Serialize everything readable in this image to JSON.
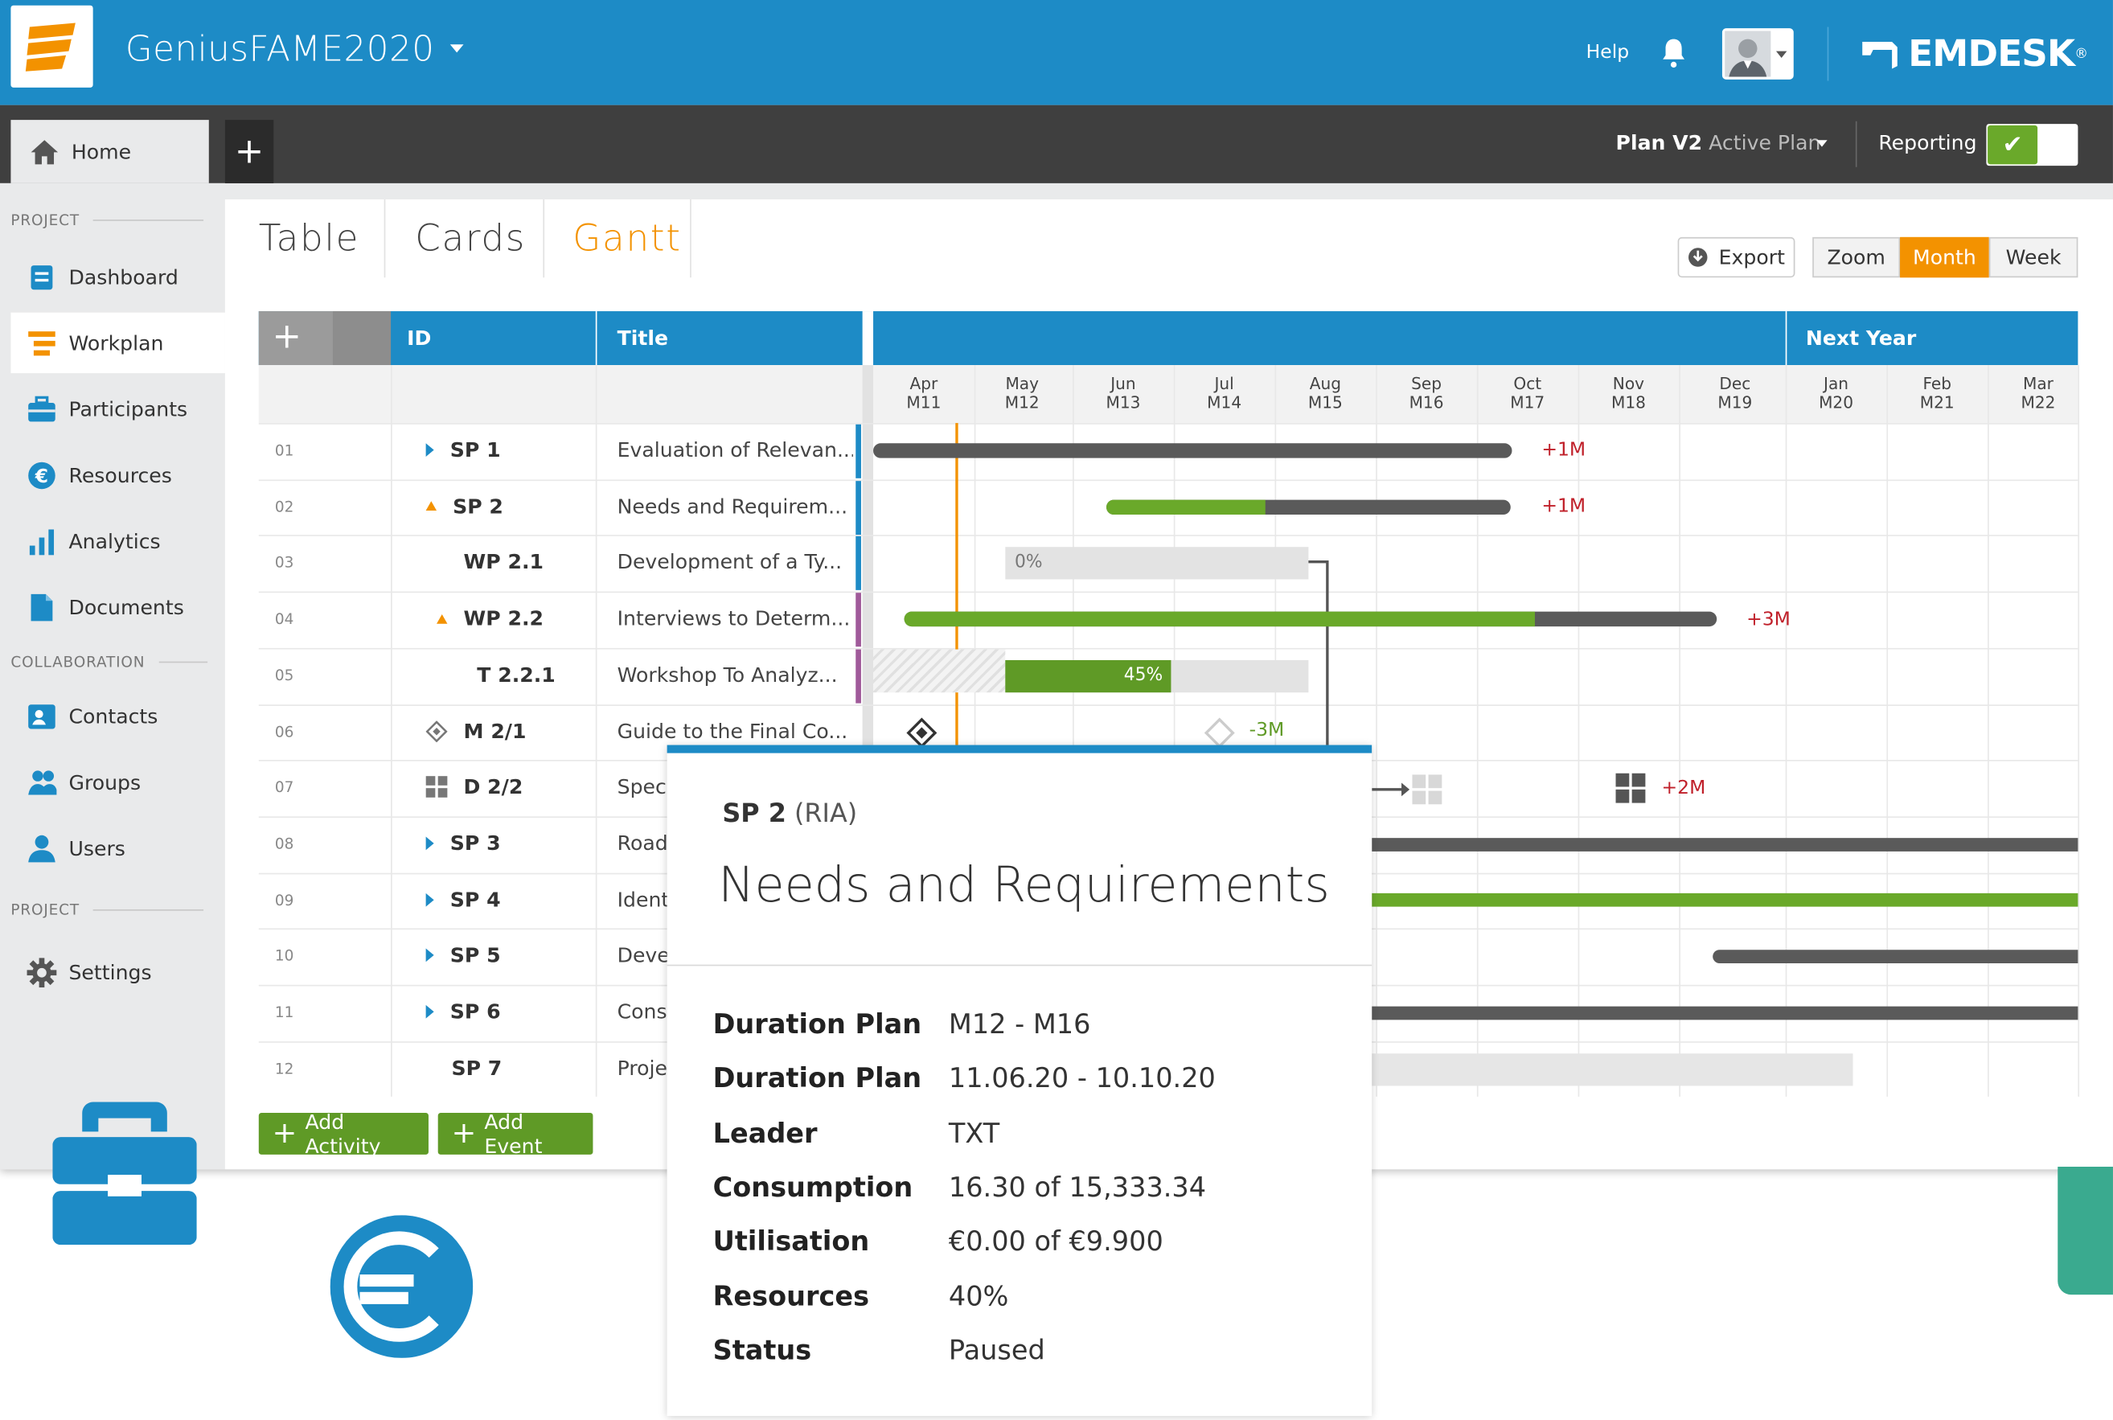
{
  "app": {
    "project": "GeniusFAME2020",
    "help": "Help",
    "brand": "EMDESK",
    "brand_mark": "®"
  },
  "subbar": {
    "home": "Home",
    "plan_name": "Plan V2",
    "plan_status": "Active Plan",
    "reporting": "Reporting"
  },
  "sidebar": {
    "sections": [
      "PROJECT",
      "COLLABORATION",
      "PROJECT"
    ],
    "items": [
      {
        "label": "Dashboard",
        "icon": "dashboard-icon"
      },
      {
        "label": "Workplan",
        "icon": "workplan-icon",
        "active": true
      },
      {
        "label": "Participants",
        "icon": "briefcase-icon"
      },
      {
        "label": "Resources",
        "icon": "euro-icon"
      },
      {
        "label": "Analytics",
        "icon": "bar-chart-icon"
      },
      {
        "label": "Documents",
        "icon": "document-icon"
      },
      {
        "label": "Contacts",
        "icon": "contact-card-icon"
      },
      {
        "label": "Groups",
        "icon": "group-icon"
      },
      {
        "label": "Users",
        "icon": "user-icon"
      },
      {
        "label": "Settings",
        "icon": "gear-icon"
      }
    ]
  },
  "views": {
    "table": "Table",
    "cards": "Cards",
    "gantt": "Gantt",
    "active": "Gantt"
  },
  "toolbar": {
    "export": "Export",
    "zoom": "Zoom",
    "month": "Month",
    "week": "Week",
    "active_zoom": "Month"
  },
  "grid": {
    "col_id": "ID",
    "col_title": "Title",
    "next_year": "Next Year",
    "months": [
      {
        "m": "Apr",
        "n": "M11"
      },
      {
        "m": "May",
        "n": "M12"
      },
      {
        "m": "Jun",
        "n": "M13"
      },
      {
        "m": "Jul",
        "n": "M14"
      },
      {
        "m": "Aug",
        "n": "M15"
      },
      {
        "m": "Sep",
        "n": "M16"
      },
      {
        "m": "Oct",
        "n": "M17"
      },
      {
        "m": "Nov",
        "n": "M18"
      },
      {
        "m": "Dec",
        "n": "M19"
      },
      {
        "m": "Jan",
        "n": "M20"
      },
      {
        "m": "Feb",
        "n": "M21"
      },
      {
        "m": "Mar",
        "n": "M22"
      }
    ],
    "rows": [
      {
        "num": "01",
        "id": "SP 1",
        "title": "Evaluation of Relevan...",
        "delta": "+1M"
      },
      {
        "num": "02",
        "id": "SP 2",
        "title": "Needs and Requirem...",
        "delta": "+1M"
      },
      {
        "num": "03",
        "id": "WP 2.1",
        "title": "Development of a Ty...",
        "progress": "0%"
      },
      {
        "num": "04",
        "id": "WP 2.2",
        "title": "Interviews to Determ...",
        "delta": "+3M"
      },
      {
        "num": "05",
        "id": "T 2.2.1",
        "title": "Workshop To Analyz...",
        "progress": "45%"
      },
      {
        "num": "06",
        "id": "M 2/1",
        "title": "Guide to the Final Co...",
        "delta": "-3M"
      },
      {
        "num": "07",
        "id": "D 2/2",
        "title": "Spec",
        "delta": "+2M"
      },
      {
        "num": "08",
        "id": "SP 3",
        "title": "Road"
      },
      {
        "num": "09",
        "id": "SP 4",
        "title": "Ident"
      },
      {
        "num": "10",
        "id": "SP 5",
        "title": "Deve"
      },
      {
        "num": "11",
        "id": "SP 6",
        "title": "Cons"
      },
      {
        "num": "12",
        "id": "SP 7",
        "title": "Proje"
      }
    ]
  },
  "actions": {
    "add_activity": "Add Activity",
    "add_event": "Add Event"
  },
  "popup": {
    "code": "SP 2",
    "type": "(RIA)",
    "title": "Needs and Requirements",
    "fields": [
      {
        "k": "Duration Plan",
        "v": "M12 - M16"
      },
      {
        "k": "Duration Plan",
        "v": "11.06.20 - 10.10.20"
      },
      {
        "k": "Leader",
        "v": "TXT"
      },
      {
        "k": "Consumption",
        "v": "16.30 of 15,333.34"
      },
      {
        "k": "Utilisation",
        "v": "€0.00 of €9.900"
      },
      {
        "k": "Resources",
        "v": "40%"
      },
      {
        "k": "Status",
        "v": "Paused"
      }
    ]
  },
  "colors": {
    "blue": "#1d8bc6",
    "orange": "#f39200",
    "green": "#6aa92a",
    "bar_dark": "#5a5a5a",
    "red": "#c0202a"
  }
}
